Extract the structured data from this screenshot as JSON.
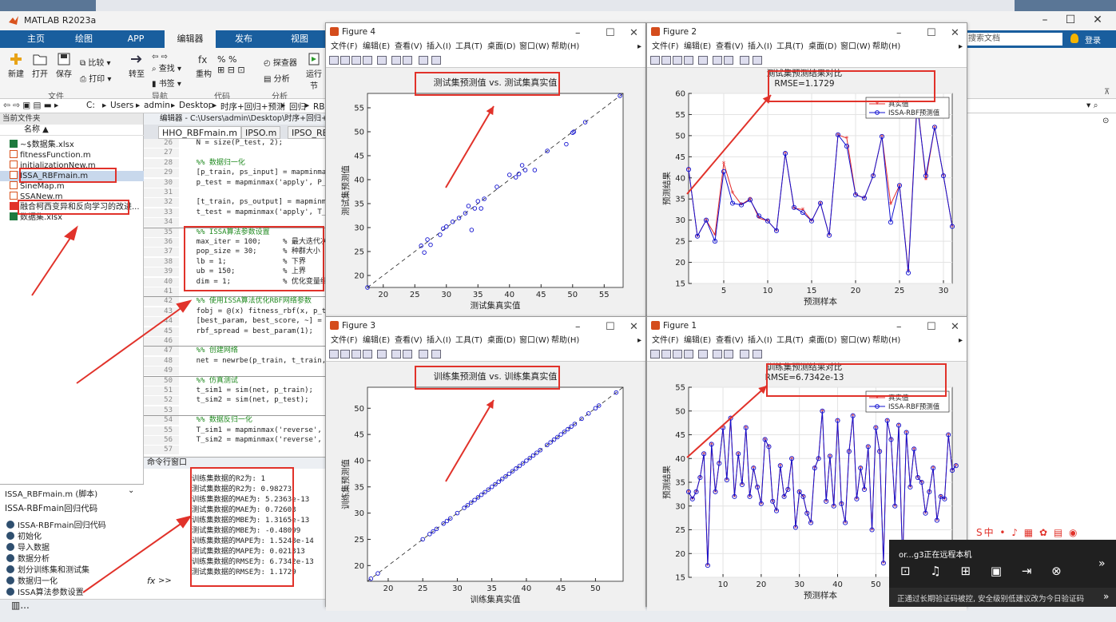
{
  "app": {
    "title": "MATLAB R2023a",
    "tabs": [
      "主页",
      "绘图",
      "APP",
      "编辑器",
      "发布",
      "视图"
    ],
    "active_tab": "编辑器",
    "search_placeholder": "搜索文档",
    "login": "登录",
    "ribbon": {
      "file": [
        "新建",
        "打开",
        "保存"
      ],
      "compare": "比较",
      "print": "打印",
      "goto": "转至",
      "find": "查找",
      "bookmark": "书签",
      "refactor": "重构",
      "code_analyzer": "探查器",
      "analyze": "分析",
      "run_section": "运行节",
      "sections": [
        "文件",
        "导航",
        "代码",
        "分析"
      ]
    },
    "address": [
      "C:",
      "Users",
      "admin",
      "Desktop",
      "时序+回归+预测",
      "回归",
      "RBF回"
    ]
  },
  "file_panel": {
    "header": "当前文件夹",
    "name_col": "名称 ▲",
    "items": [
      "~$数据集.xlsx",
      "fitnessFunction.m",
      "initializationNew.m",
      "ISSA_RBFmain.m",
      "SineMap.m",
      "SSANew.m",
      "融合柯西变异和反向学习的改进...",
      "数据集.xlsx"
    ]
  },
  "detail_panel": {
    "file": "ISSA_RBFmain.m (脚本)",
    "title": "ISSA-RBFmain回归代码",
    "items": [
      "ISSA-RBFmain回归代码",
      "初始化",
      "导入数据",
      "数据分析",
      "划分训练集和测试集",
      "数据归一化",
      "ISSA算法参数设置"
    ]
  },
  "editor": {
    "path": "编辑器 - C:\\Users\\admin\\Desktop\\时序+回归+预测\\",
    "tabs": [
      "HHO_RBFmain.m",
      "IPSO.m",
      "IPSO_RB"
    ],
    "lines": [
      {
        "n": "26",
        "code": "    N = size(P_test, 2);"
      },
      {
        "n": "27",
        "code": ""
      },
      {
        "n": "28",
        "code": "    %% 数据归一化",
        "cm": true
      },
      {
        "n": "29",
        "code": "    [p_train, ps_input] = mapminmax"
      },
      {
        "n": "30",
        "code": "    p_test = mapminmax('apply', P_t"
      },
      {
        "n": "31",
        "code": ""
      },
      {
        "n": "32",
        "code": "    [t_train, ps_output] = mapminma"
      },
      {
        "n": "33",
        "code": "    t_test = mapminmax('apply', T_t"
      },
      {
        "n": "34",
        "code": ""
      },
      {
        "n": "35",
        "code": "    %% ISSA算法参数设置",
        "cm": true,
        "sep": true
      },
      {
        "n": "36",
        "code": "    max_iter = 100;     % 最大迭代次"
      },
      {
        "n": "37",
        "code": "    pop_size = 30;      % 种群大小"
      },
      {
        "n": "38",
        "code": "    lb = 1;             % 下界"
      },
      {
        "n": "39",
        "code": "    ub = 150;           % 上界"
      },
      {
        "n": "40",
        "code": "    dim = 1;            % 优化变量维"
      },
      {
        "n": "41",
        "code": ""
      },
      {
        "n": "42",
        "code": "    %% 使用ISSA算法优化RBF网络参数",
        "cm": true,
        "sep": true
      },
      {
        "n": "43",
        "code": "    fobj = @(x) fitness_rbf(x, p_tr"
      },
      {
        "n": "44",
        "code": "    [best_param, best_score, ~] = S"
      },
      {
        "n": "45",
        "code": "    rbf_spread = best_param(1);"
      },
      {
        "n": "46",
        "code": ""
      },
      {
        "n": "47",
        "code": "    %% 创建网络",
        "cm": true,
        "sep": true
      },
      {
        "n": "48",
        "code": "    net = newrbe(p_train, t_train,"
      },
      {
        "n": "49",
        "code": ""
      },
      {
        "n": "50",
        "code": "    %% 仿真测试",
        "cm": true,
        "sep": true
      },
      {
        "n": "51",
        "code": "    t_sim1 = sim(net, p_train);"
      },
      {
        "n": "52",
        "code": "    t_sim2 = sim(net, p_test);"
      },
      {
        "n": "53",
        "code": ""
      },
      {
        "n": "54",
        "code": "    %% 数据反归一化",
        "cm": true,
        "sep": true
      },
      {
        "n": "55",
        "code": "    T_sim1 = mapminmax('reverse', t"
      },
      {
        "n": "56",
        "code": "    T_sim2 = mapminmax('reverse', t"
      },
      {
        "n": "57",
        "code": ""
      }
    ]
  },
  "command_window": {
    "header": "命令行窗口",
    "lines": [
      "训练集数据的R2为: 1",
      "测试集数据的R2为: 0.98273",
      "训练集数据的MAE为: 5.2363e-13",
      "测试集数据的MAE为: 0.72603",
      "训练集数据的MBE为: 1.3165e-13",
      "测试集数据的MBE为: -0.48099",
      "训练集数据的MAPE为: 1.5248e-14",
      "测试集数据的MAPE为: 0.021313",
      "训练集数据的RMSE为: 6.7342e-13",
      "测试集数据的RMSE为: 1.1729"
    ],
    "prompt": ">>"
  },
  "figure_menu": [
    "文件(F)",
    "编辑(E)",
    "查看(V)",
    "插入(I)",
    "工具(T)",
    "桌面(D)",
    "窗口(W)",
    "帮助(H)"
  ],
  "figures": {
    "fig4": {
      "title": "Figure 4",
      "plot_title": "测试集预测值 vs. 测试集真实值",
      "xlabel": "测试集真实值",
      "ylabel": "测试集预测值"
    },
    "fig2": {
      "title": "Figure 2",
      "plot_title": "测试集预测结果对比",
      "subtitle": "RMSE=1.1729",
      "xlabel": "预测样本",
      "ylabel": "预测结果",
      "legend": [
        "真实值",
        "ISSA-RBF预测值"
      ]
    },
    "fig3": {
      "title": "Figure 3",
      "plot_title": "训练集预测值 vs. 训练集真实值",
      "xlabel": "训练集真实值",
      "ylabel": "训练集预测值"
    },
    "fig1": {
      "title": "Figure 1",
      "plot_title": "训练集预测结果对比",
      "subtitle": "RMSE=6.7342e-13",
      "xlabel": "预测样本",
      "ylabel": "预测结果",
      "legend": [
        "真实值",
        "ISSA-RBF预测值"
      ]
    }
  },
  "chart_data": [
    {
      "type": "scatter",
      "name_ref": "fig4",
      "title": "测试集预测值 vs. 测试集真实值",
      "xlabel": "测试集真实值",
      "ylabel": "测试集预测值",
      "xlim": [
        17.5,
        58
      ],
      "ylim": [
        17.5,
        58
      ],
      "xticks": [
        20,
        25,
        30,
        35,
        40,
        45,
        50,
        55
      ],
      "yticks": [
        20,
        25,
        30,
        35,
        40,
        45,
        50,
        55
      ],
      "x": [
        17.5,
        26,
        26.5,
        27,
        27.5,
        29,
        29.5,
        30,
        31,
        32,
        33,
        33.5,
        34,
        34.5,
        35,
        35.5,
        36,
        38,
        40,
        41,
        41.5,
        42,
        42.5,
        44,
        46,
        49,
        50,
        50.2,
        52,
        57.5
      ],
      "y": [
        17.5,
        26.2,
        24.8,
        27.5,
        26.4,
        28.5,
        29.8,
        30.2,
        31.2,
        32,
        33,
        34.5,
        29.5,
        34,
        35.5,
        34,
        36,
        38.5,
        41,
        40.5,
        41.2,
        43,
        42,
        42,
        46,
        47.4,
        49.8,
        50,
        52,
        57.5
      ],
      "diagonal": true
    },
    {
      "type": "line",
      "name_ref": "fig2",
      "title": "测试集预测结果对比",
      "subtitle": "RMSE=1.1729",
      "xlabel": "预测样本",
      "ylabel": "预测结果",
      "xlim": [
        1,
        31
      ],
      "ylim": [
        15,
        60
      ],
      "xticks": [
        5,
        10,
        15,
        20,
        25,
        30
      ],
      "yticks": [
        15,
        20,
        25,
        30,
        35,
        40,
        45,
        50,
        55,
        60
      ],
      "legend_position": "top-right",
      "series": [
        {
          "name": "真实值",
          "color": "#e32a2a",
          "marker": "star",
          "values": [
            42,
            26.2,
            30,
            26.5,
            43.5,
            36.5,
            33.7,
            35,
            30.5,
            29.8,
            27.5,
            45.8,
            32.8,
            32.5,
            29.8,
            34,
            26.4,
            50.2,
            49.4,
            36.1,
            35.2,
            40.5,
            49.8,
            33.8,
            38.2,
            18,
            58.5,
            39.6,
            52,
            40.5,
            28.5
          ]
        },
        {
          "name": "ISSA-RBF预测值",
          "color": "#1010d0",
          "marker": "circle",
          "values": [
            42,
            26.2,
            30,
            25,
            41.5,
            34,
            33.6,
            34.8,
            31,
            29.8,
            27.5,
            45.8,
            33,
            31.8,
            29.8,
            34,
            26.4,
            50.2,
            47.5,
            36,
            35.2,
            40.5,
            49.8,
            29.5,
            38.2,
            17.5,
            57.5,
            40.5,
            52,
            40.5,
            28.5
          ]
        }
      ]
    },
    {
      "type": "scatter",
      "name_ref": "fig3",
      "title": "训练集预测值 vs. 训练集真实值",
      "xlabel": "训练集真实值",
      "ylabel": "训练集预测值",
      "xlim": [
        17,
        54
      ],
      "ylim": [
        17,
        54
      ],
      "xticks": [
        20,
        25,
        30,
        35,
        40,
        45,
        50
      ],
      "yticks": [
        20,
        25,
        30,
        35,
        40,
        45,
        50
      ],
      "x": [
        17.5,
        18.5,
        25,
        26,
        26.5,
        27,
        28,
        28.5,
        29,
        30,
        31,
        31.5,
        32,
        32.5,
        33,
        33.5,
        34,
        34.5,
        35,
        35.5,
        36,
        36.5,
        37,
        37.5,
        38,
        38.5,
        39,
        39.5,
        40,
        40.5,
        41,
        41.5,
        42,
        43,
        43.5,
        44,
        44.5,
        45,
        45.5,
        46,
        46.5,
        47,
        48,
        49,
        50,
        50.5,
        53
      ],
      "y": [
        17.5,
        18.5,
        25,
        26,
        26.5,
        27,
        28,
        28.5,
        29,
        30,
        31,
        31.5,
        32,
        32.5,
        33,
        33.5,
        34,
        34.5,
        35,
        35.5,
        36,
        36.5,
        37,
        37.5,
        38,
        38.5,
        39,
        39.5,
        40,
        40.5,
        41,
        41.5,
        42,
        43,
        43.5,
        44,
        44.5,
        45,
        45.5,
        46,
        46.5,
        47,
        48,
        49,
        50,
        50.5,
        53
      ],
      "diagonal": true
    },
    {
      "type": "line",
      "name_ref": "fig1",
      "title": "训练集预测结果对比",
      "subtitle": "RMSE=6.7342e-13",
      "xlabel": "预测样本",
      "ylabel": "预测结果",
      "xlim": [
        1,
        70
      ],
      "ylim": [
        15,
        55
      ],
      "xticks": [
        10,
        20,
        30,
        40,
        50
      ],
      "yticks": [
        15,
        20,
        25,
        30,
        35,
        40,
        45,
        50,
        55
      ],
      "legend_position": "top-right",
      "series": [
        {
          "name": "真实值",
          "color": "#e32a2a",
          "marker": "star",
          "values": [
            33,
            31.5,
            33,
            36,
            41,
            17.5,
            43,
            33,
            39,
            46.5,
            35.5,
            48.5,
            32,
            41,
            34.5,
            46.5,
            32,
            38,
            34,
            30.5,
            44,
            42.5,
            31,
            29,
            38.5,
            32,
            33.5,
            40,
            25.5,
            33,
            32,
            28.5,
            26.5,
            38,
            40,
            50,
            31,
            40.5,
            30,
            48,
            30.5,
            26.5,
            41.5,
            49,
            31.5,
            38,
            33.5,
            42.5,
            25,
            46.5,
            41.5,
            18,
            48,
            44,
            30,
            47,
            18,
            45.5,
            34,
            42,
            36,
            35,
            28.5,
            33,
            38,
            27,
            32,
            31.5,
            45,
            37.5,
            38.5
          ]
        },
        {
          "name": "ISSA-RBF预测值",
          "color": "#1010d0",
          "marker": "circle",
          "values": [
            33,
            31.5,
            33,
            36,
            41,
            17.5,
            43,
            33,
            39,
            46.5,
            35.5,
            48.5,
            32,
            41,
            34.5,
            46.5,
            32,
            38,
            34,
            30.5,
            44,
            42.5,
            31,
            29,
            38.5,
            32,
            33.5,
            40,
            25.5,
            33,
            32,
            28.5,
            26.5,
            38,
            40,
            50,
            31,
            40.5,
            30,
            48,
            30.5,
            26.5,
            41.5,
            49,
            31.5,
            38,
            33.5,
            42.5,
            25,
            46.5,
            41.5,
            18,
            48,
            44,
            30,
            47,
            18,
            45.5,
            34,
            42,
            36,
            35,
            28.5,
            33,
            38,
            27,
            32,
            31.5,
            45,
            37.5,
            38.5
          ]
        }
      ]
    }
  ],
  "notification": {
    "title": "or...g3正在远程本机",
    "body": "正通过长期验证码被控, 安全级别低建议改为今日验证码"
  },
  "colors": {
    "ribbon_blue": "#195e9e",
    "highlight_red": "#e1322a",
    "true_series": "#e32a2a",
    "pred_series": "#1010d0"
  }
}
